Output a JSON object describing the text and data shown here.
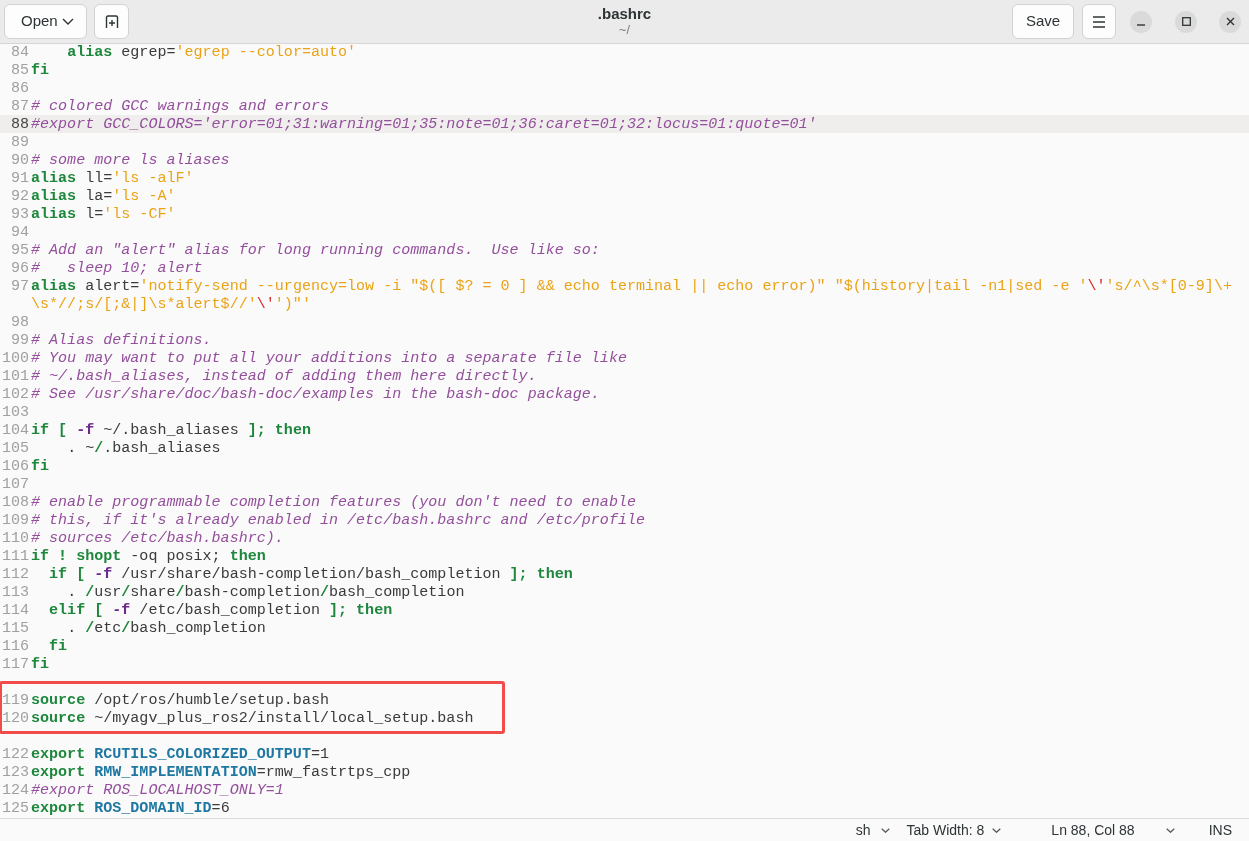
{
  "header": {
    "open_button": "Open",
    "title": ".bashrc",
    "subtitle": "~/",
    "save_button": "Save"
  },
  "editor": {
    "lines": [
      {
        "number": "84",
        "current": false,
        "boxed": false,
        "tokens": [
          {
            "kind": "keyword",
            "text": "    alias"
          },
          {
            "kind": "plain",
            "text": " egrep="
          },
          {
            "kind": "string",
            "text": "'egrep --color=auto'"
          }
        ]
      },
      {
        "number": "85",
        "current": false,
        "boxed": false,
        "tokens": [
          {
            "kind": "keyword",
            "text": "fi"
          }
        ]
      },
      {
        "number": "86",
        "current": false,
        "boxed": false
      },
      {
        "number": "87",
        "current": false,
        "boxed": false,
        "tokens": [
          {
            "kind": "comment",
            "text": "# colored GCC warnings and errors"
          }
        ]
      },
      {
        "number": "88",
        "current": true,
        "boxed": false,
        "tokens": [
          {
            "kind": "comment",
            "text": "#export GCC_COLORS='error=01;31:warning=01;35:note=01;36:caret=01;32:locus=01:quote=01'"
          }
        ]
      },
      {
        "number": "89",
        "current": false,
        "boxed": false
      },
      {
        "number": "90",
        "current": false,
        "boxed": false,
        "tokens": [
          {
            "kind": "comment",
            "text": "# some more ls aliases"
          }
        ]
      },
      {
        "number": "91",
        "current": false,
        "boxed": false,
        "tokens": [
          {
            "kind": "keyword",
            "text": "alias"
          },
          {
            "kind": "plain",
            "text": " ll="
          },
          {
            "kind": "string",
            "text": "'ls -alF'"
          }
        ]
      },
      {
        "number": "92",
        "current": false,
        "boxed": false,
        "tokens": [
          {
            "kind": "keyword",
            "text": "alias"
          },
          {
            "kind": "plain",
            "text": " la="
          },
          {
            "kind": "string",
            "text": "'ls -A'"
          }
        ]
      },
      {
        "number": "93",
        "current": false,
        "boxed": false,
        "tokens": [
          {
            "kind": "keyword",
            "text": "alias"
          },
          {
            "kind": "plain",
            "text": " l="
          },
          {
            "kind": "string",
            "text": "'ls -CF'"
          }
        ]
      },
      {
        "number": "94",
        "current": false,
        "boxed": false
      },
      {
        "number": "95",
        "current": false,
        "boxed": false,
        "tokens": [
          {
            "kind": "comment",
            "text": "# Add an \"alert\" alias for long running commands.  Use like so:"
          }
        ]
      },
      {
        "number": "96",
        "current": false,
        "boxed": false,
        "tokens": [
          {
            "kind": "comment",
            "text": "#   sleep 10; alert"
          }
        ]
      },
      {
        "number": "97",
        "current": false,
        "boxed": false,
        "tokens": [
          {
            "kind": "keyword",
            "text": "alias"
          },
          {
            "kind": "plain",
            "text": " alert="
          },
          {
            "kind": "string",
            "text": "'notify-send --urgency=low -i \"$([ $? = 0 ] && echo terminal || echo error)\" \"$(history|tail -n1|sed -e '"
          },
          {
            "kind": "escape",
            "text": "\\'"
          },
          {
            "kind": "string",
            "text": "'s/^\\s*[0-9]\\+\\s*//;s/[;&|]\\s*alert$//'"
          },
          {
            "kind": "escape",
            "text": "\\'"
          },
          {
            "kind": "string",
            "text": "')\"'"
          }
        ]
      },
      {
        "number": "98",
        "current": false,
        "boxed": false
      },
      {
        "number": "99",
        "current": false,
        "boxed": false,
        "tokens": [
          {
            "kind": "comment",
            "text": "# Alias definitions."
          }
        ]
      },
      {
        "number": "100",
        "current": false,
        "boxed": false,
        "tokens": [
          {
            "kind": "comment",
            "text": "# You may want to put all your additions into a separate file like"
          }
        ]
      },
      {
        "number": "101",
        "current": false,
        "boxed": false,
        "tokens": [
          {
            "kind": "comment",
            "text": "# ~/.bash_aliases, instead of adding them here directly."
          }
        ]
      },
      {
        "number": "102",
        "current": false,
        "boxed": false,
        "tokens": [
          {
            "kind": "comment",
            "text": "# See /usr/share/doc/bash-doc/examples in the bash-doc package."
          }
        ]
      },
      {
        "number": "103",
        "current": false,
        "boxed": false
      },
      {
        "number": "104",
        "current": false,
        "boxed": false,
        "tokens": [
          {
            "kind": "keyword",
            "text": "if ["
          },
          {
            "kind": "option",
            "text": " -f"
          },
          {
            "kind": "plain",
            "text": " ~/.bash_aliases "
          },
          {
            "kind": "keyword",
            "text": "]; then"
          }
        ]
      },
      {
        "number": "105",
        "current": false,
        "boxed": false,
        "tokens": [
          {
            "kind": "plain",
            "text": "    . ~"
          },
          {
            "kind": "keyword",
            "text": "/"
          },
          {
            "kind": "plain",
            "text": ".bash_aliases"
          }
        ]
      },
      {
        "number": "106",
        "current": false,
        "boxed": false,
        "tokens": [
          {
            "kind": "keyword",
            "text": "fi"
          }
        ]
      },
      {
        "number": "107",
        "current": false,
        "boxed": false
      },
      {
        "number": "108",
        "current": false,
        "boxed": false,
        "tokens": [
          {
            "kind": "comment",
            "text": "# enable programmable completion features (you don't need to enable"
          }
        ]
      },
      {
        "number": "109",
        "current": false,
        "boxed": false,
        "tokens": [
          {
            "kind": "comment",
            "text": "# this, if it's already enabled in /etc/bash.bashrc and /etc/profile"
          }
        ]
      },
      {
        "number": "110",
        "current": false,
        "boxed": false,
        "tokens": [
          {
            "kind": "comment",
            "text": "# sources /etc/bash.bashrc)."
          }
        ]
      },
      {
        "number": "111",
        "current": false,
        "boxed": false,
        "tokens": [
          {
            "kind": "keyword",
            "text": "if ! shopt"
          },
          {
            "kind": "plain",
            "text": " -oq posix; "
          },
          {
            "kind": "keyword",
            "text": "then"
          }
        ]
      },
      {
        "number": "112",
        "current": false,
        "boxed": false,
        "tokens": [
          {
            "kind": "keyword",
            "text": "  if ["
          },
          {
            "kind": "option",
            "text": " -f"
          },
          {
            "kind": "plain",
            "text": " /usr/share/bash-completion/bash_completion "
          },
          {
            "kind": "keyword",
            "text": "]; then"
          }
        ]
      },
      {
        "number": "113",
        "current": false,
        "boxed": false,
        "tokens": [
          {
            "kind": "plain",
            "text": "    . "
          },
          {
            "kind": "keyword",
            "text": "/"
          },
          {
            "kind": "plain",
            "text": "usr"
          },
          {
            "kind": "keyword",
            "text": "/"
          },
          {
            "kind": "plain",
            "text": "share"
          },
          {
            "kind": "keyword",
            "text": "/"
          },
          {
            "kind": "plain",
            "text": "bash-completion"
          },
          {
            "kind": "keyword",
            "text": "/"
          },
          {
            "kind": "plain",
            "text": "bash_completion"
          }
        ]
      },
      {
        "number": "114",
        "current": false,
        "boxed": false,
        "tokens": [
          {
            "kind": "keyword",
            "text": "  elif ["
          },
          {
            "kind": "option",
            "text": " -f"
          },
          {
            "kind": "plain",
            "text": " /etc/bash_completion "
          },
          {
            "kind": "keyword",
            "text": "]; then"
          }
        ]
      },
      {
        "number": "115",
        "current": false,
        "boxed": false,
        "tokens": [
          {
            "kind": "plain",
            "text": "    . "
          },
          {
            "kind": "keyword",
            "text": "/"
          },
          {
            "kind": "plain",
            "text": "etc"
          },
          {
            "kind": "keyword",
            "text": "/"
          },
          {
            "kind": "plain",
            "text": "bash_completion"
          }
        ]
      },
      {
        "number": "116",
        "current": false,
        "boxed": false,
        "tokens": [
          {
            "kind": "keyword",
            "text": "  fi"
          }
        ]
      },
      {
        "number": "117",
        "current": false,
        "boxed": false,
        "tokens": [
          {
            "kind": "keyword",
            "text": "fi"
          }
        ]
      },
      {
        "current": false,
        "boxed": false
      },
      {
        "number": "119",
        "current": false,
        "boxed": true,
        "tokens": [
          {
            "kind": "keyword",
            "text": "source"
          },
          {
            "kind": "plain",
            "text": " /opt/ros/humble/setup.bash"
          }
        ]
      },
      {
        "number": "120",
        "current": false,
        "boxed": true,
        "tokens": [
          {
            "kind": "keyword",
            "text": "source"
          },
          {
            "kind": "plain",
            "text": " ~/myagv_plus_ros2/install/local_setup.bash"
          }
        ]
      },
      {
        "current": false,
        "boxed": false
      },
      {
        "number": "122",
        "current": false,
        "boxed": false,
        "tokens": [
          {
            "kind": "keyword",
            "text": "export"
          },
          {
            "kind": "variable",
            "text": " RCUTILS_COLORIZED_OUTPUT"
          },
          {
            "kind": "plain",
            "text": "=1"
          }
        ]
      },
      {
        "number": "123",
        "current": false,
        "boxed": false,
        "tokens": [
          {
            "kind": "keyword",
            "text": "export"
          },
          {
            "kind": "variable",
            "text": " RMW_IMPLEMENTATION"
          },
          {
            "kind": "plain",
            "text": "=rmw_fastrtps_cpp"
          }
        ]
      },
      {
        "number": "124",
        "current": false,
        "boxed": false,
        "tokens": [
          {
            "kind": "comment",
            "text": "#export ROS_LOCALHOST_ONLY=1"
          }
        ]
      },
      {
        "number": "125",
        "current": false,
        "boxed": false,
        "tokens": [
          {
            "kind": "keyword",
            "text": "export"
          },
          {
            "kind": "variable",
            "text": " ROS_DOMAIN_ID"
          },
          {
            "kind": "plain",
            "text": "=6"
          }
        ]
      }
    ]
  },
  "status_bar": {
    "language": "sh",
    "tab_width": "Tab Width: 8",
    "cursor_position": "Ln 88, Col 88",
    "input_mode": "INS"
  }
}
